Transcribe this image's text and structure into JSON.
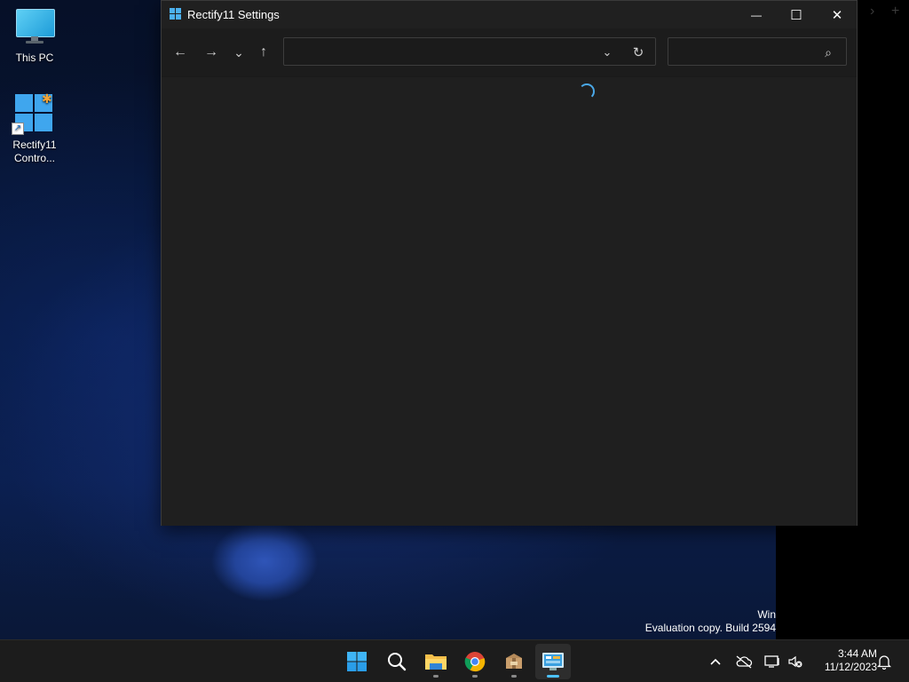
{
  "desktop": {
    "icons": [
      {
        "label": "This PC",
        "icon": "monitor-icon"
      },
      {
        "label": "Rectify11\nContro...",
        "icon": "rectify11-control-panel-icon"
      }
    ],
    "watermark": {
      "line1": "Win",
      "line2": "Evaluation copy. Build 2594"
    }
  },
  "window": {
    "title": "Rectify11 Settings",
    "controls": {
      "minimize": "—",
      "maximize": "☐",
      "close": "✕"
    },
    "toolbar": {
      "back": "←",
      "forward": "→",
      "recent": "⌄",
      "up": "↑",
      "address_value": "",
      "dropdown": "⌄",
      "refresh": "↻",
      "search_value": "",
      "search_glyph": "⌕"
    },
    "content": {
      "state": "loading"
    }
  },
  "taskbar": {
    "apps": [
      {
        "name": "Start",
        "icon": "windows-start-icon"
      },
      {
        "name": "Search",
        "icon": "search-icon"
      },
      {
        "name": "File Explorer",
        "icon": "file-explorer-icon"
      },
      {
        "name": "Google Chrome",
        "icon": "chrome-icon"
      },
      {
        "name": "Archive",
        "icon": "package-icon"
      },
      {
        "name": "Rectify11 Control Panel",
        "icon": "control-panel-icon",
        "active": true
      }
    ],
    "tray": {
      "chevron": "^",
      "clock_time": "3:44 AM",
      "clock_date": "11/12/2023"
    }
  },
  "colors": {
    "accent": "#4cc2ff",
    "window_bg": "#202020",
    "taskbar_bg": "#1c1c1c"
  }
}
